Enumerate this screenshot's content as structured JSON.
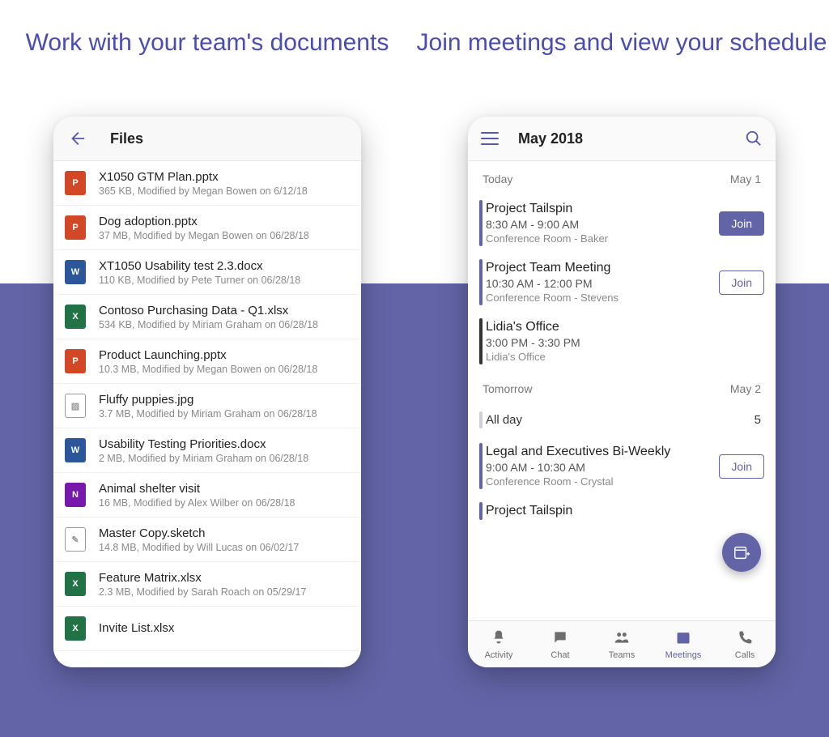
{
  "headlines": {
    "left": "Work with your team's documents",
    "right": "Join meetings and view your schedule"
  },
  "files_screen": {
    "title": "Files",
    "files": [
      {
        "icon": "pptx",
        "badge": "P",
        "name": "X1050 GTM Plan.pptx",
        "meta": "365 KB,  Modified by  Megan Bowen  on 6/12/18"
      },
      {
        "icon": "pptx",
        "badge": "P",
        "name": "Dog adoption.pptx",
        "meta": "37 MB,  Modified by  Megan Bowen  on 06/28/18"
      },
      {
        "icon": "docx",
        "badge": "W",
        "name": "XT1050 Usability test 2.3.docx",
        "meta": "110 KB,  Modified by  Pete Turner  on 06/28/18"
      },
      {
        "icon": "xlsx",
        "badge": "X",
        "name": "Contoso Purchasing Data - Q1.xlsx",
        "meta": "534 KB,  Modified by  Miriam Graham  on 06/28/18"
      },
      {
        "icon": "pptx",
        "badge": "P",
        "name": "Product Launching.pptx",
        "meta": "10.3 MB,  Modified by  Megan Bowen  on 06/28/18"
      },
      {
        "icon": "img",
        "badge": "▨",
        "name": "Fluffy puppies.jpg",
        "meta": "3.7 MB,  Modified by  Miriam Graham  on 06/28/18"
      },
      {
        "icon": "docx",
        "badge": "W",
        "name": "Usability Testing Priorities.docx",
        "meta": "2 MB,  Modified by  Miriam Graham  on 06/28/18"
      },
      {
        "icon": "one",
        "badge": "N",
        "name": "Animal shelter visit",
        "meta": "16 MB,  Modified by  Alex Wilber  on 06/28/18"
      },
      {
        "icon": "sketch",
        "badge": "✎",
        "name": "Master Copy.sketch",
        "meta": "14.8 MB,  Modified by  Will Lucas  on 06/02/17"
      },
      {
        "icon": "xlsx",
        "badge": "X",
        "name": "Feature Matrix.xlsx",
        "meta": "2.3 MB,  Modified by  Sarah Roach  on 05/29/17"
      },
      {
        "icon": "xlsx",
        "badge": "X",
        "name": "Invite List.xlsx",
        "meta": ""
      }
    ]
  },
  "meetings_screen": {
    "title": "May 2018",
    "sections": [
      {
        "label": "Today",
        "date": "May 1",
        "events": [
          {
            "title": "Project Tailspin",
            "time": "8:30 AM - 9:00 AM",
            "loc": "Conference Room - Baker",
            "bar": "purple",
            "join": "primary"
          },
          {
            "title": "Project Team Meeting",
            "time": "10:30 AM - 12:00 PM",
            "loc": "Conference Room - Stevens",
            "bar": "purple",
            "join": "outline"
          },
          {
            "title": "Lidia's Office",
            "time": "3:00 PM - 3:30 PM",
            "loc": "Lidia's Office",
            "bar": "dark",
            "join": "none"
          }
        ]
      },
      {
        "label": "Tomorrow",
        "date": "May 2",
        "allday": {
          "label": "All day",
          "count": "5"
        },
        "events": [
          {
            "title": "Legal and Executives Bi-Weekly",
            "time": "9:00 AM - 10:30 AM",
            "loc": "Conference Room - Crystal",
            "bar": "purple",
            "join": "outline"
          },
          {
            "title": "Project Tailspin",
            "time": "",
            "loc": "",
            "bar": "purple",
            "join": "none"
          }
        ]
      }
    ],
    "join_label": "Join",
    "tabs": [
      {
        "id": "activity",
        "label": "Activity"
      },
      {
        "id": "chat",
        "label": "Chat"
      },
      {
        "id": "teams",
        "label": "Teams"
      },
      {
        "id": "meetings",
        "label": "Meetings",
        "active": true
      },
      {
        "id": "calls",
        "label": "Calls"
      }
    ]
  }
}
